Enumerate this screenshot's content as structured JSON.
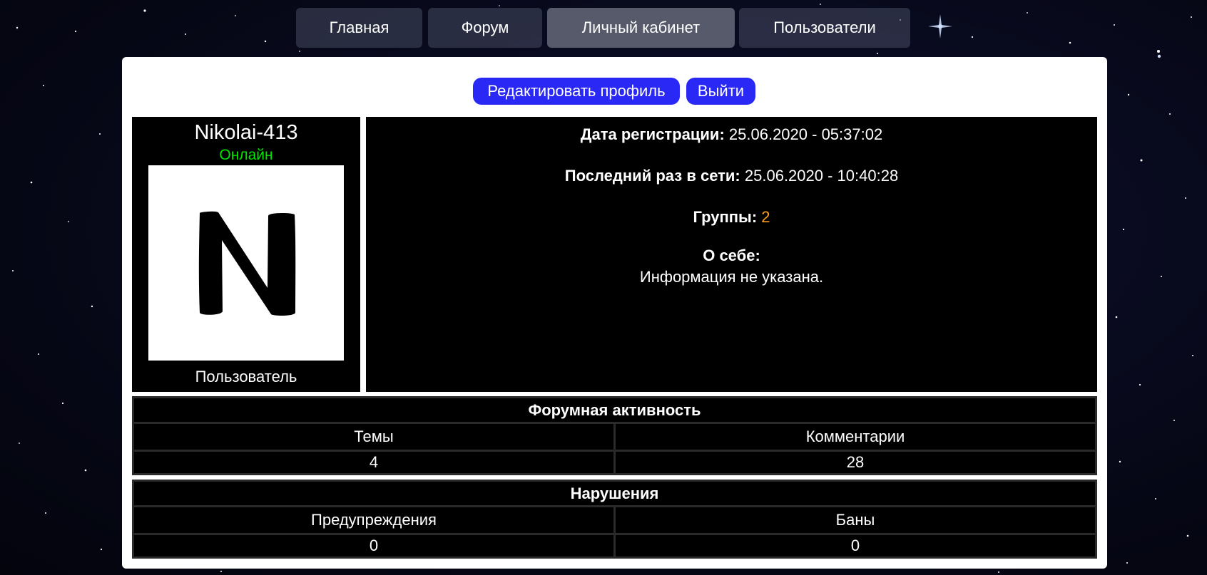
{
  "nav": {
    "tabs": [
      {
        "label": "Главная"
      },
      {
        "label": "Форум"
      },
      {
        "label": "Личный кабинет"
      },
      {
        "label": "Пользователи"
      }
    ]
  },
  "actions": {
    "edit_profile": "Редактировать профиль",
    "logout": "Выйти"
  },
  "profile": {
    "username": "Nikolai-413",
    "status": "Онлайн",
    "avatar_letter": "N",
    "role": "Пользователь",
    "registration_label": "Дата регистрации:",
    "registration_value": "25.06.2020 - 05:37:02",
    "last_seen_label": "Последний раз в сети:",
    "last_seen_value": "25.06.2020 - 10:40:28",
    "groups_label": "Группы:",
    "groups_value": "2",
    "about_label": "О себе:",
    "about_value": "Информация не указана."
  },
  "forum_activity": {
    "title": "Форумная активность",
    "columns": [
      "Темы",
      "Комментарии"
    ],
    "values": [
      "4",
      "28"
    ]
  },
  "violations": {
    "title": "Нарушения",
    "columns": [
      "Предупреждения",
      "Баны"
    ],
    "values": [
      "0",
      "0"
    ]
  },
  "colors": {
    "button": "#2a28f5",
    "online": "#00e600",
    "highlight": "#ff9e1f"
  }
}
